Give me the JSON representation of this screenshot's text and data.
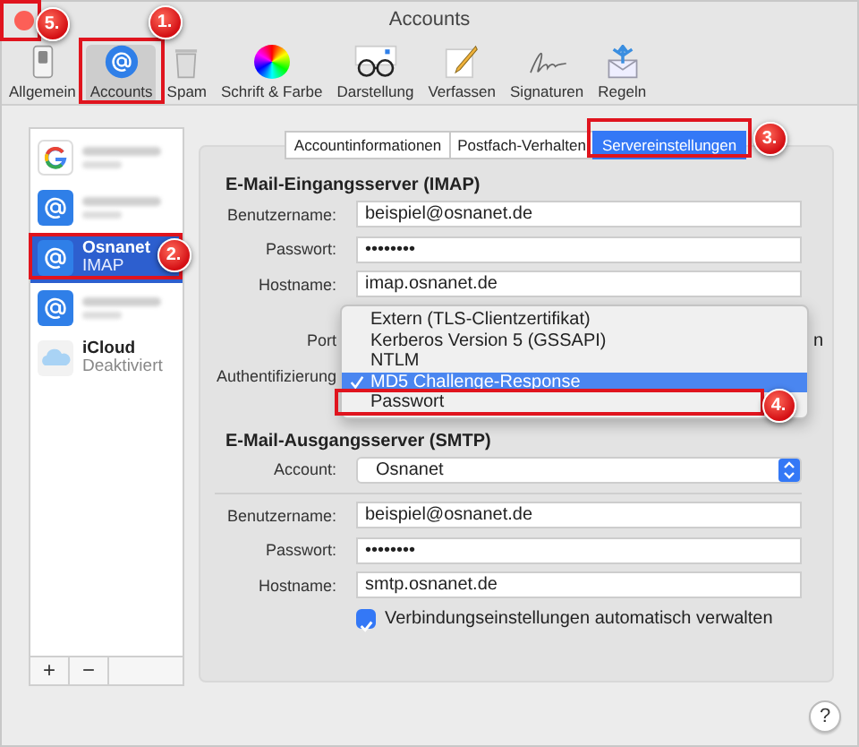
{
  "window": {
    "title": "Accounts"
  },
  "toolbar": [
    {
      "label": "Allgemein",
      "kind": "switch",
      "selected": false
    },
    {
      "label": "Accounts",
      "kind": "at",
      "selected": true
    },
    {
      "label": "Spam",
      "kind": "trash",
      "selected": false
    },
    {
      "label": "Schrift & Farbe",
      "kind": "wheel",
      "selected": false
    },
    {
      "label": "Darstellung",
      "kind": "glasses",
      "selected": false
    },
    {
      "label": "Verfassen",
      "kind": "pencil",
      "selected": false
    },
    {
      "label": "Signaturen",
      "kind": "signature",
      "selected": false
    },
    {
      "label": "Regeln",
      "kind": "rules",
      "selected": false
    }
  ],
  "accounts": [
    {
      "kind": "google",
      "selected": false
    },
    {
      "kind": "at",
      "selected": false
    },
    {
      "kind": "at",
      "name": "Osnanet",
      "detail": "IMAP",
      "selected": true
    },
    {
      "kind": "at",
      "selected": false
    },
    {
      "kind": "cloud",
      "name": "iCloud",
      "detail": "Deaktiviert",
      "selected": false
    }
  ],
  "sidebar_buttons": [
    "+",
    "−"
  ],
  "tabs": [
    {
      "label": "Accountinformationen",
      "selected": false
    },
    {
      "label": "Postfach-Verhalten",
      "selected": false
    },
    {
      "label": "Servereinstellungen",
      "selected": true
    }
  ],
  "incoming": {
    "heading": "E-Mail-Eingangsserver (IMAP)",
    "fields": [
      {
        "label": "Benutzername:",
        "value": "beispiel@osnanet.de"
      },
      {
        "label": "Passwort:",
        "value": "••••••••"
      },
      {
        "label": "Hostname:",
        "value": "imap.osnanet.de"
      }
    ],
    "port_label": "Port",
    "port_trailing_text": "n",
    "auth_label": "Authentifizierung"
  },
  "auth_menu": [
    {
      "label": "Extern (TLS-Clientzertifikat)",
      "selected": false
    },
    {
      "label": "Kerberos Version 5 (GSSAPI)",
      "selected": false
    },
    {
      "label": "NTLM",
      "selected": false
    },
    {
      "label": "MD5 Challenge-Response",
      "selected": true
    },
    {
      "label": "Passwort",
      "selected": false
    }
  ],
  "outgoing": {
    "heading": "E-Mail-Ausgangsserver (SMTP)",
    "account": {
      "label": "Account:",
      "value": "Osnanet"
    },
    "fields": [
      {
        "label": "Benutzername:",
        "value": "beispiel@osnanet.de"
      },
      {
        "label": "Passwort:",
        "value": "••••••••"
      },
      {
        "label": "Hostname:",
        "value": "smtp.osnanet.de"
      }
    ],
    "auto_manage": {
      "label": "Verbindungseinstellungen automatisch verwalten",
      "checked": true
    }
  },
  "help": "?",
  "annotations": [
    {
      "number": "5."
    },
    {
      "number": "1."
    },
    {
      "number": "2."
    },
    {
      "number": "3."
    },
    {
      "number": "4."
    }
  ]
}
